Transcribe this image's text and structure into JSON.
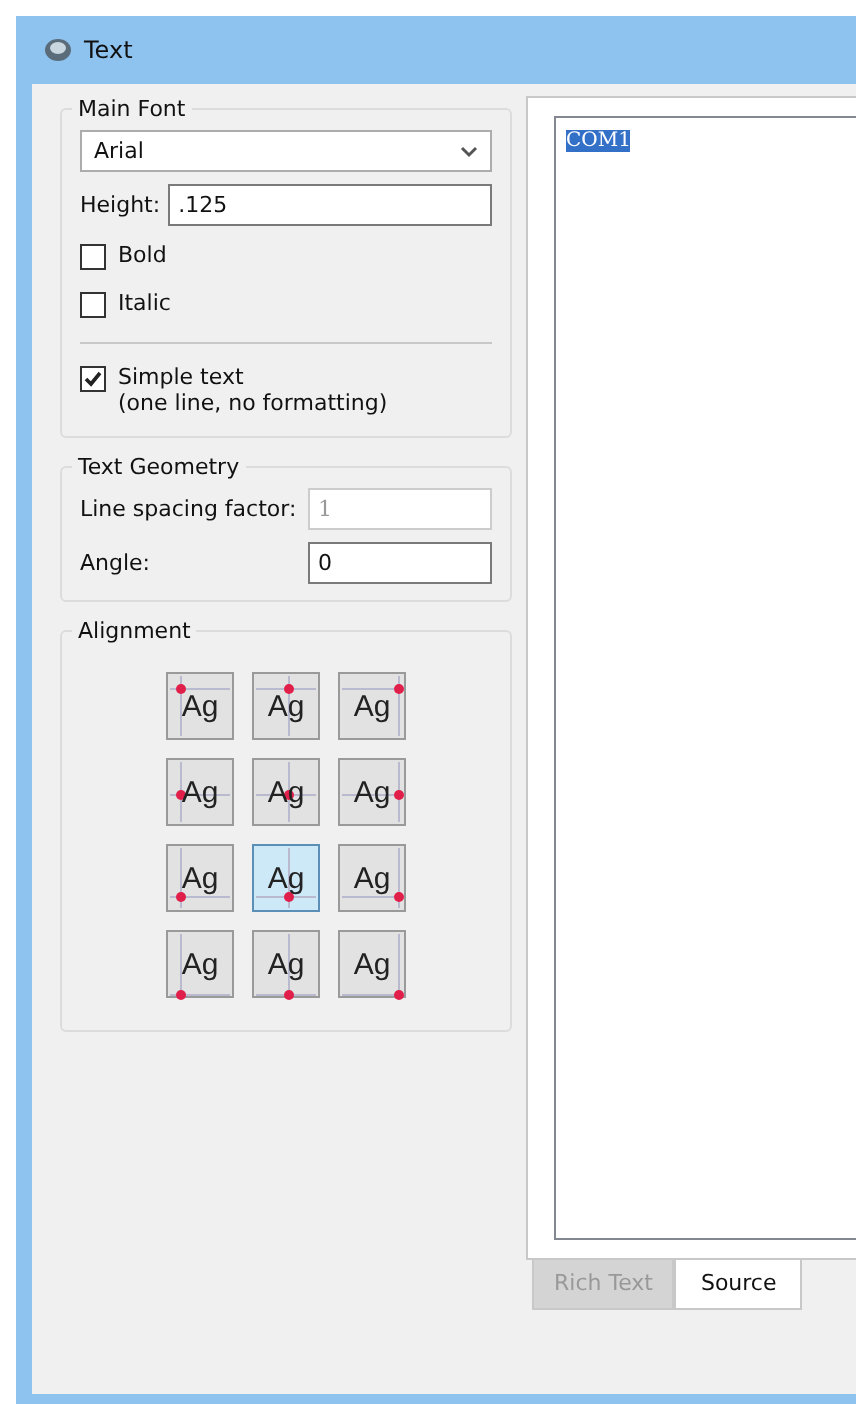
{
  "window": {
    "title": "Text"
  },
  "main_font": {
    "title": "Main Font",
    "font": "Arial",
    "height_label": "Height:",
    "height": ".125",
    "options": [
      {
        "label": "Bold",
        "checked": false,
        "kind": "plain"
      },
      {
        "label": "Italic",
        "checked": false,
        "kind": "plain"
      },
      {
        "label": "Simple text\n(one line, no formatting)",
        "checked": true,
        "kind": "separated"
      }
    ]
  },
  "text_geometry": {
    "title": "Text Geometry",
    "fields": [
      {
        "label": "Line spacing factor:",
        "value": "1",
        "disabled": true
      },
      {
        "label": "Angle:",
        "value": "0",
        "disabled": false
      }
    ]
  },
  "alignment": {
    "title": "Alignment",
    "buttons": [
      {
        "label": "Ag",
        "kind": "top_left",
        "selected": false
      },
      {
        "label": "Ag",
        "kind": "top_center",
        "selected": false
      },
      {
        "label": "Ag",
        "kind": "top_right",
        "selected": false
      },
      {
        "label": "Ag",
        "kind": "middle_left",
        "selected": false
      },
      {
        "label": "Ag",
        "kind": "middle_center",
        "selected": false
      },
      {
        "label": "Ag",
        "kind": "middle_right",
        "selected": false
      },
      {
        "label": "Ag",
        "kind": "baseline_left",
        "selected": false
      },
      {
        "label": "Ag",
        "kind": "baseline_center",
        "selected": true
      },
      {
        "label": "Ag",
        "kind": "baseline_right",
        "selected": false
      },
      {
        "label": "Ag",
        "kind": "bottom_left",
        "selected": false
      },
      {
        "label": "Ag",
        "kind": "bottom_center",
        "selected": false
      },
      {
        "label": "Ag",
        "kind": "bottom_right",
        "selected": false
      }
    ]
  },
  "editor": {
    "text": "COM1",
    "selected": true
  },
  "tabs": [
    {
      "label": "Rich Text",
      "selected": false
    },
    {
      "label": "Source",
      "selected": true
    }
  ]
}
